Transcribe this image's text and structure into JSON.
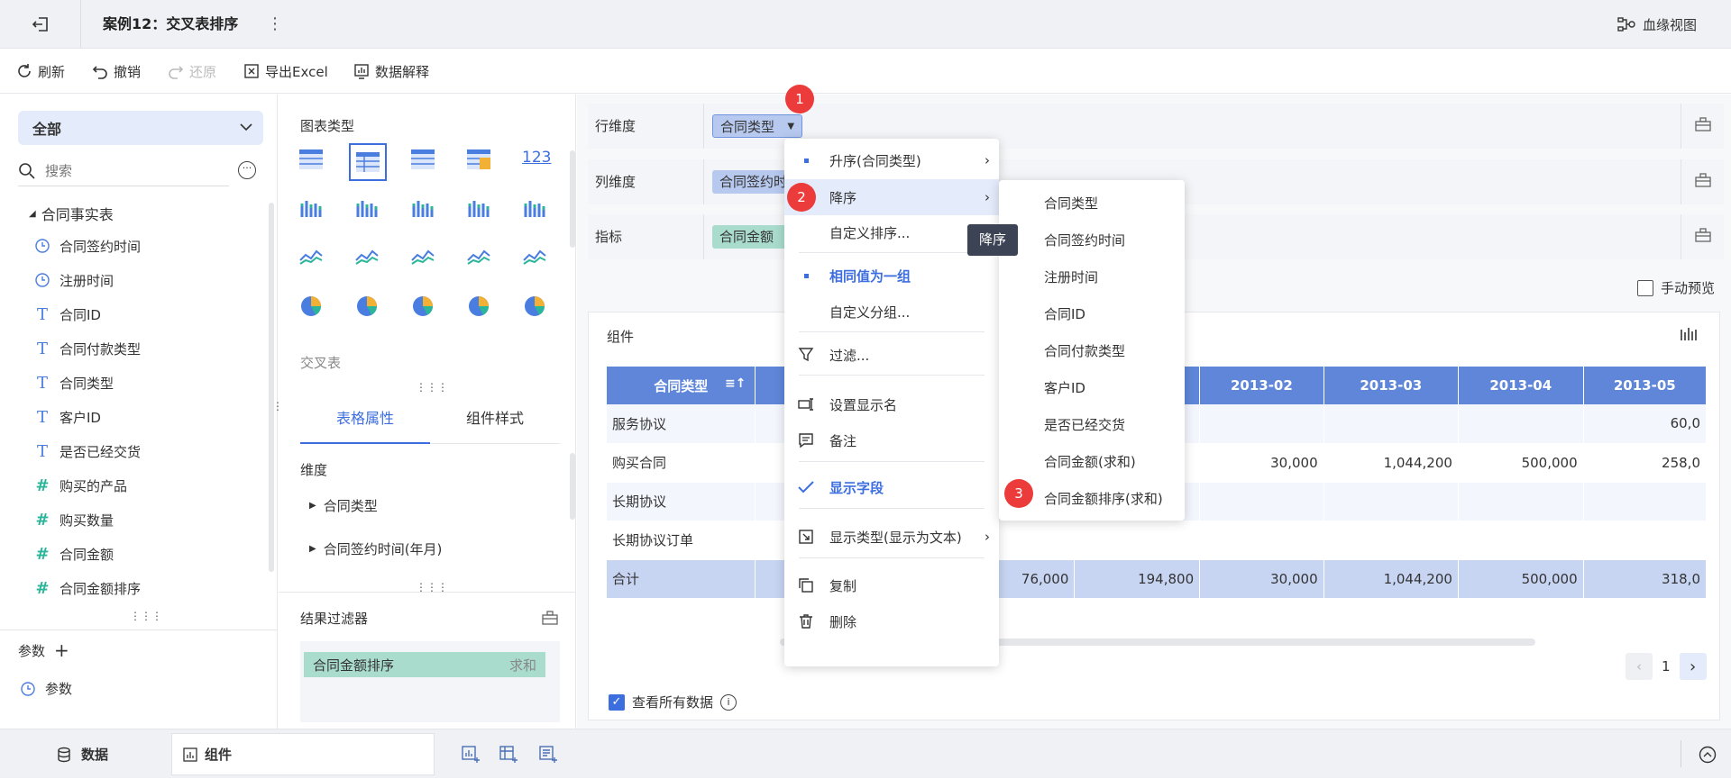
{
  "header": {
    "title": "案例12：交叉表排序",
    "lineage_label": "血缘视图"
  },
  "toolbar": {
    "refresh": "刷新",
    "undo": "撤销",
    "redo": "还原",
    "export": "导出Excel",
    "explain": "数据解释"
  },
  "left": {
    "scope": "全部",
    "search_placeholder": "搜索",
    "table_name": "合同事实表",
    "fields": [
      {
        "label": "合同签约时间",
        "icon": "clock-icon"
      },
      {
        "label": "注册时间",
        "icon": "clock-icon"
      },
      {
        "label": "合同ID",
        "icon": "text-type-icon"
      },
      {
        "label": "合同付款类型",
        "icon": "text-type-icon"
      },
      {
        "label": "合同类型",
        "icon": "text-type-icon"
      },
      {
        "label": "客户ID",
        "icon": "text-type-icon"
      },
      {
        "label": "是否已经交货",
        "icon": "text-type-icon"
      },
      {
        "label": "购买的产品",
        "icon": "number-type-icon"
      },
      {
        "label": "购买数量",
        "icon": "number-type-icon"
      },
      {
        "label": "合同金额",
        "icon": "number-type-icon"
      },
      {
        "label": "合同金额排序",
        "icon": "number-type-icon"
      }
    ],
    "param_header": "参数",
    "param_item": "参数"
  },
  "middle": {
    "chart_type_label": "图表类型",
    "crosstab_label": "交叉表",
    "tab_props": "表格属性",
    "tab_style": "组件样式",
    "dimension_label": "维度",
    "dim_items": [
      "合同类型",
      "合同签约时间(年月)"
    ],
    "result_filter_label": "结果过滤器",
    "filter_pill": "合同金额排序",
    "filter_agg": "求和"
  },
  "config": {
    "row_label": "行维度",
    "row_pill": "合同类型",
    "col_label": "列维度",
    "col_pill": "合同签约时",
    "metric_label": "指标",
    "metric_pill": "合同金额",
    "manual_preview": "手动预览"
  },
  "table": {
    "component_label": "组件",
    "header_first": "合同类型",
    "columns": [
      "2013-02",
      "2013-03",
      "2013-04",
      "2013-05"
    ],
    "rows": [
      {
        "label": "服务协议",
        "partial": "",
        "c1": "",
        "values": [
          "",
          "",
          "",
          "60,0"
        ]
      },
      {
        "label": "购买合同",
        "partial": "",
        "c1": "",
        "values": [
          "30,000",
          "1,044,200",
          "500,000",
          "258,0"
        ]
      },
      {
        "label": "长期协议",
        "partial": "",
        "c1": "",
        "values": [
          "",
          "",
          "",
          ""
        ]
      },
      {
        "label": "长期协议订单",
        "partial": "",
        "c1": "",
        "values": [
          "",
          "",
          "",
          ""
        ]
      },
      {
        "label": "合计",
        "partial": "76,000",
        "c1": "194,800",
        "values": [
          "30,000",
          "1,044,200",
          "500,000",
          "318,0"
        ]
      }
    ],
    "view_all": "查看所有数据",
    "page": "1"
  },
  "context_menu": {
    "items": [
      {
        "label": "升序(合同类型)"
      },
      {
        "label": "降序"
      },
      {
        "label": "自定义排序..."
      },
      {
        "label": "相同值为一组"
      },
      {
        "label": "自定义分组..."
      },
      {
        "label": "过滤..."
      },
      {
        "label": "设置显示名"
      },
      {
        "label": "备注"
      },
      {
        "label": "显示字段"
      },
      {
        "label": "显示类型(显示为文本)"
      },
      {
        "label": "复制"
      },
      {
        "label": "删除"
      }
    ]
  },
  "submenu": {
    "items": [
      "合同类型",
      "合同签约时间",
      "注册时间",
      "合同ID",
      "合同付款类型",
      "客户ID",
      "是否已经交货",
      "合同金额(求和)",
      "合同金额排序(求和)"
    ]
  },
  "tooltip": "降序",
  "badges": [
    "1",
    "2",
    "3"
  ],
  "bottom": {
    "data_tab": "数据",
    "component_tab": "组件"
  },
  "colors": {
    "accent": "#3d6ee0",
    "table_header": "#5f86d9",
    "badge": "#ec3b3b",
    "tooltip": "#3b4354"
  }
}
